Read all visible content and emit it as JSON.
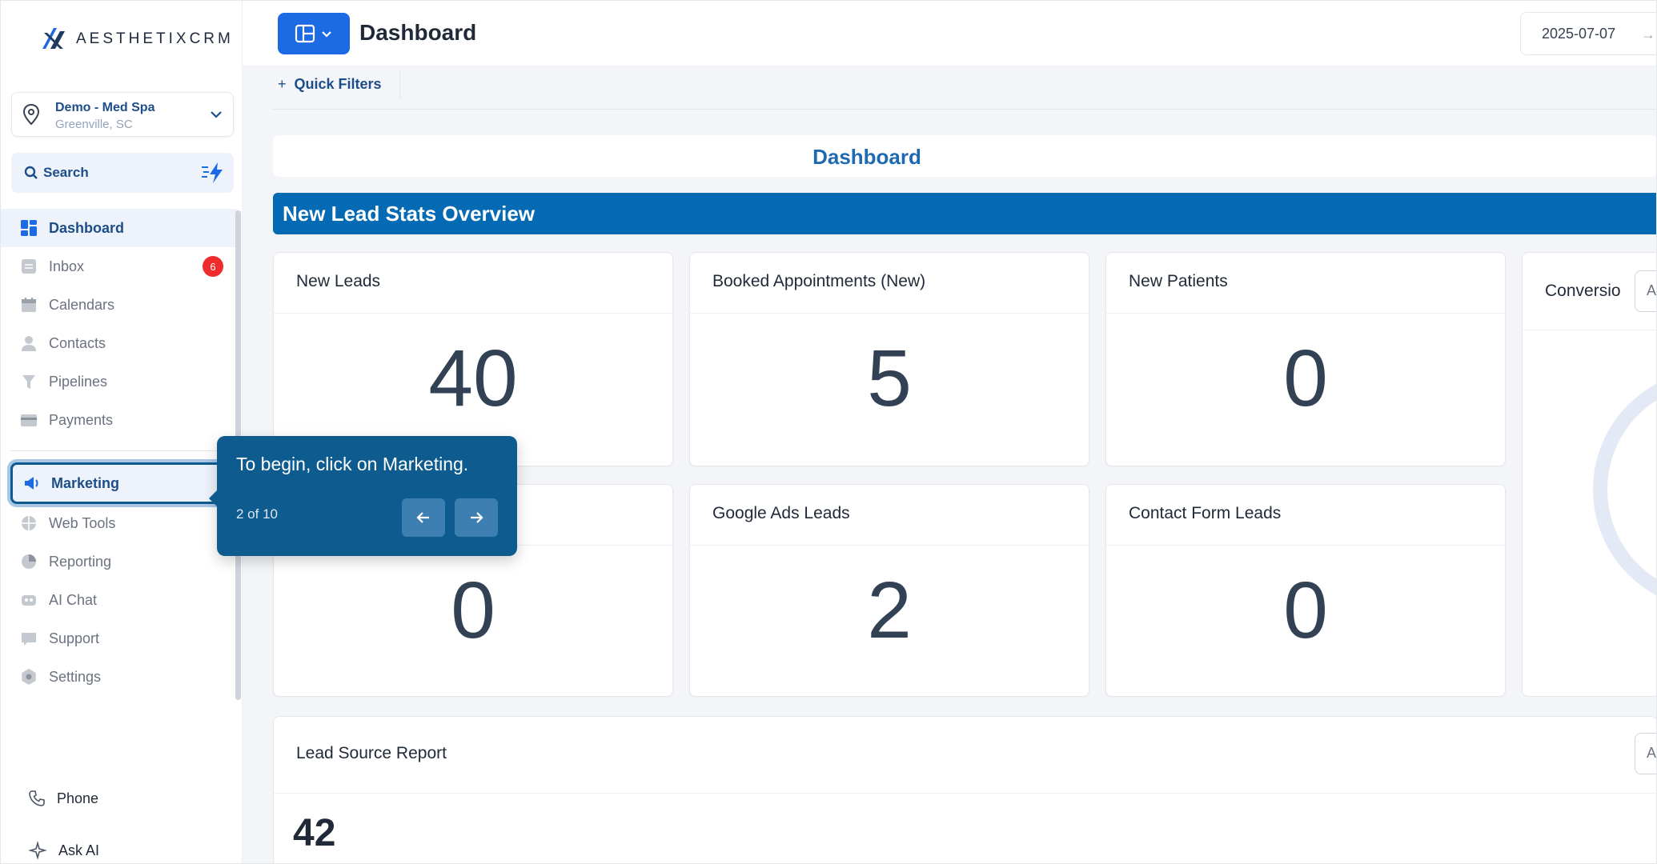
{
  "brand": {
    "logo_text": "AESTHETIXCRM"
  },
  "location": {
    "name": "Demo - Med Spa",
    "city": "Greenville, SC"
  },
  "search": {
    "label": "Search"
  },
  "sidebar": {
    "items": [
      {
        "label": "Dashboard",
        "icon": "dashboard-icon",
        "active": true
      },
      {
        "label": "Inbox",
        "icon": "inbox-icon",
        "badge": "6"
      },
      {
        "label": "Calendars",
        "icon": "calendar-icon"
      },
      {
        "label": "Contacts",
        "icon": "person-icon"
      },
      {
        "label": "Pipelines",
        "icon": "funnel-icon"
      },
      {
        "label": "Payments",
        "icon": "card-icon"
      }
    ],
    "items2": [
      {
        "label": "Marketing",
        "icon": "megaphone-icon",
        "highlighted": true
      },
      {
        "label": "Web Tools",
        "icon": "globe-icon"
      },
      {
        "label": "Reporting",
        "icon": "pie-chart-icon"
      },
      {
        "label": "AI Chat",
        "icon": "robot-icon"
      },
      {
        "label": "Support",
        "icon": "chat-icon"
      },
      {
        "label": "Settings",
        "icon": "gear-icon"
      }
    ],
    "phone": "Phone",
    "ask_ai": "Ask AI"
  },
  "topbar": {
    "title": "Dashboard",
    "date": "2025-07-07",
    "date_arrow": "→"
  },
  "quick_filters": {
    "label": "Quick Filters",
    "icon": "+"
  },
  "dashboard_header": "Dashboard",
  "section": {
    "title": "New Lead Stats Overview"
  },
  "cards": [
    {
      "title": "New Leads",
      "value": "40"
    },
    {
      "title": "Booked Appointments (New)",
      "value": "5"
    },
    {
      "title": "New Patients",
      "value": "0"
    },
    {
      "title": "",
      "value": "0"
    },
    {
      "title": "Google Ads Leads",
      "value": "2"
    },
    {
      "title": "Contact Form Leads",
      "value": "0"
    }
  ],
  "conversion": {
    "title": "Conversio",
    "select": "A"
  },
  "report": {
    "title": "Lead Source Report",
    "value": "42",
    "select": "A"
  },
  "tooltip": {
    "text": "To begin, click on Marketing.",
    "step": "2 of 10"
  },
  "colors": {
    "primary": "#046ab3",
    "accent": "#1d6ae5",
    "tooltip": "#0d5b8f",
    "badge": "#ef2b2b"
  }
}
